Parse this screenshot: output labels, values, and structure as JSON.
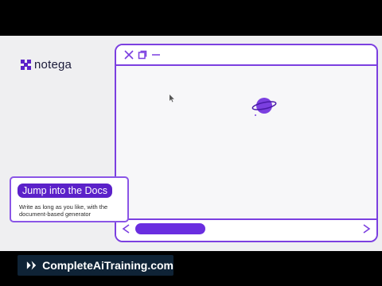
{
  "logo": {
    "text": "notega"
  },
  "browser": {
    "status_strip_text": "...",
    "accent_color": "#7b3fe0"
  },
  "callout": {
    "title": "Jump into the Docs",
    "description": "Write as long as you like, with the document-based generator"
  },
  "watermark": {
    "text": "CompleteAiTraining.com"
  },
  "colors": {
    "stage": "#efeff1",
    "pill": "#6a2ee0",
    "callout_title_bg": "#5b21c9",
    "watermark_bg": "#0f2336"
  }
}
